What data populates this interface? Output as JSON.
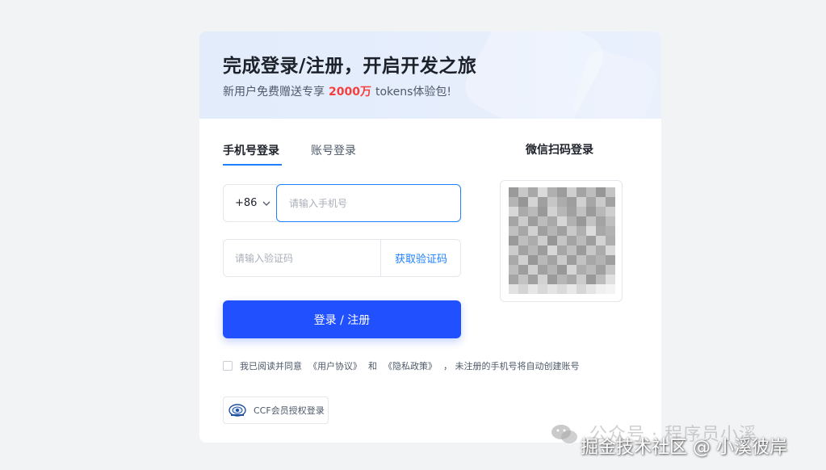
{
  "header": {
    "title": "完成登录/注册，开启开发之旅",
    "subtitle_pre": "新用户免费赠送专享",
    "subtitle_highlight": "2000万",
    "subtitle_post": "tokens体验包!"
  },
  "tabs": [
    {
      "label": "手机号登录",
      "active": true
    },
    {
      "label": "账号登录",
      "active": false
    }
  ],
  "phone": {
    "country_code": "+86",
    "placeholder": "请输入手机号",
    "value": ""
  },
  "code": {
    "placeholder": "请输入验证码",
    "value": "",
    "get_code_label": "获取验证码"
  },
  "login_button_label": "登录 / 注册",
  "agreement": {
    "checked": false,
    "text_pre": "我已阅读并同意",
    "user_agreement": "《用户协议》",
    "and": "和",
    "privacy_policy": "《隐私政策》",
    "text_post": "，  未注册的手机号将自动创建账号"
  },
  "ccf_button_label": "CCF会员授权登录",
  "wechat": {
    "title": "微信扫码登录"
  },
  "watermark": {
    "line1": "公众号 · 程序员小溪",
    "line2": "掘金技术社区 @ 小溪彼岸"
  },
  "colors": {
    "primary": "#2150ff",
    "link": "#1e80ff",
    "highlight": "#f53f3f",
    "header_bg": "#e2ecfb",
    "page_bg": "#f2f3f5"
  }
}
